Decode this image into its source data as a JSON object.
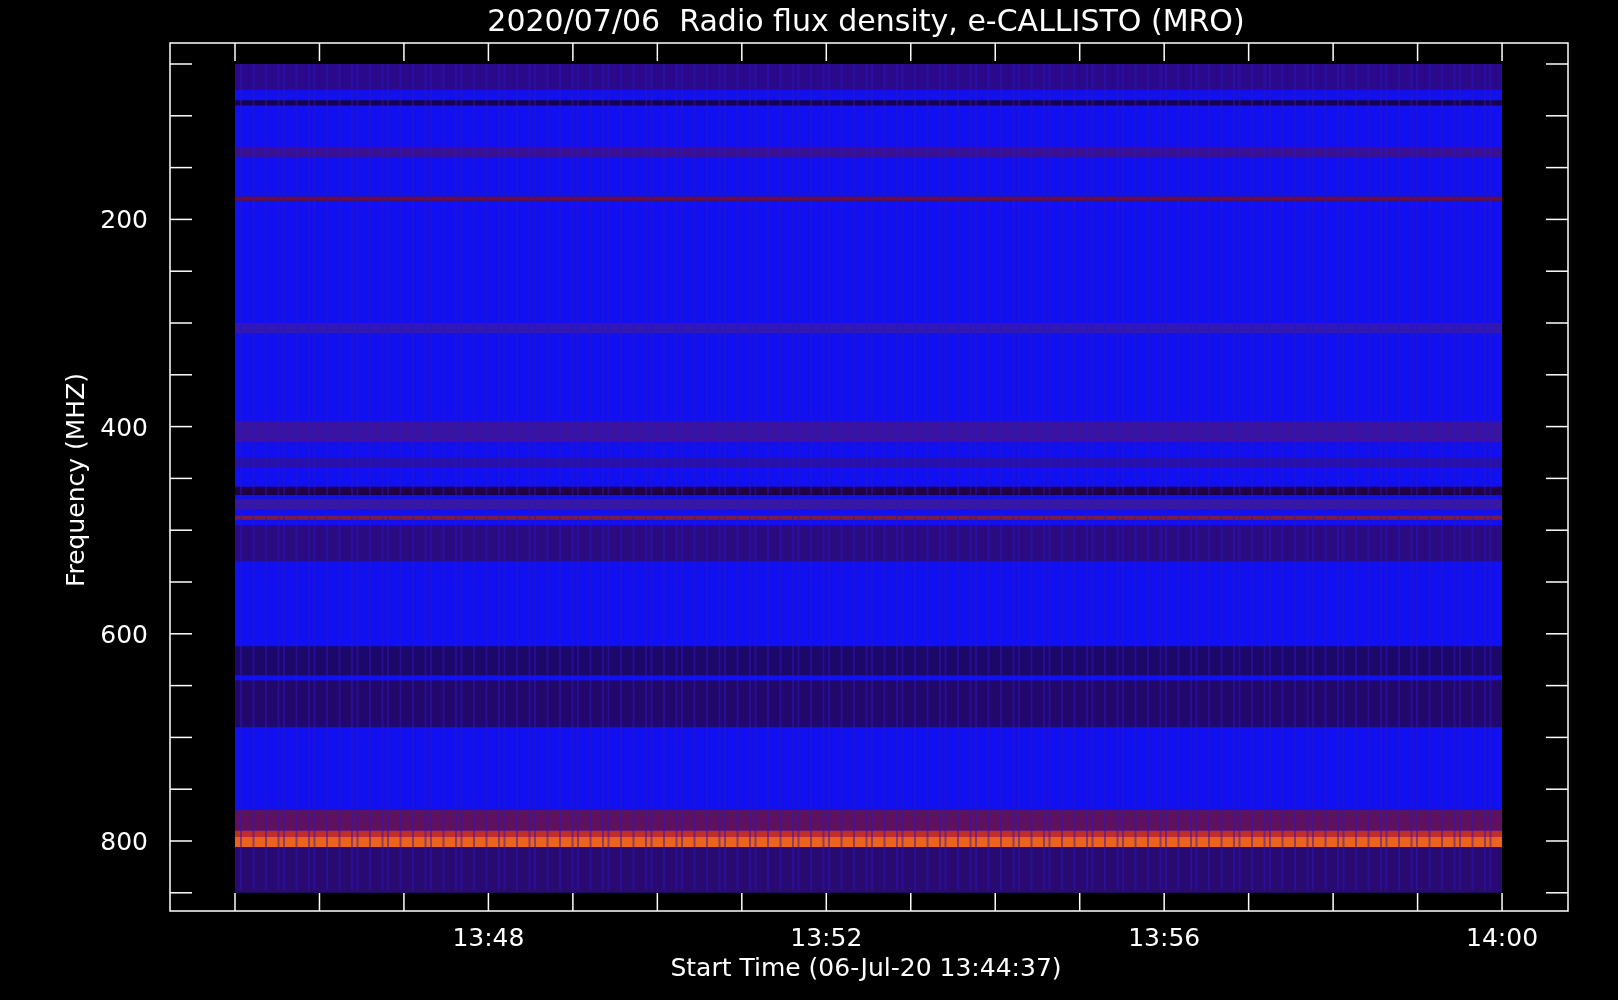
{
  "title": "2020/07/06  Radio flux density, e-CALLISTO (MRO)",
  "plot": {
    "ylabel": "Frequency (MHZ)",
    "xlabel": "Start Time (06-Jul-20 13:44:37)",
    "yticks": [
      "200",
      "400",
      "600",
      "800"
    ],
    "xticks": [
      "13:48",
      "13:52",
      "13:56",
      "14:00"
    ]
  }
}
